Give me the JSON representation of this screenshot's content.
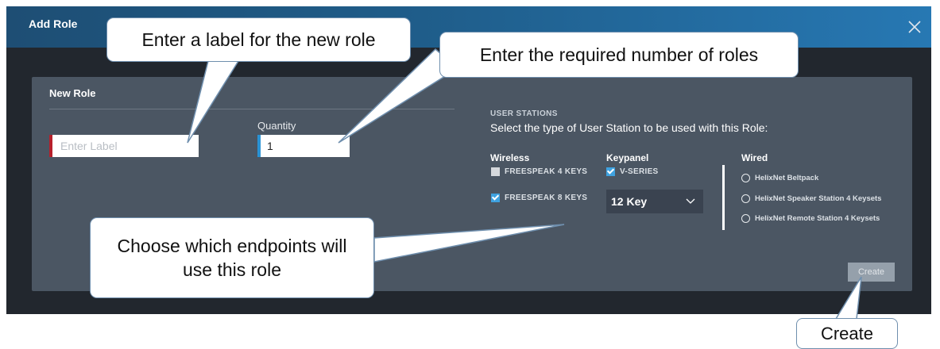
{
  "dialog": {
    "title": "Add Role",
    "close_icon": "close-icon"
  },
  "form": {
    "section_title": "New Role",
    "label_placeholder": "Enter Label",
    "label_value": "",
    "quantity_label": "Quantity",
    "quantity_value": "1"
  },
  "user_stations": {
    "heading": "USER STATIONS",
    "subheading": "Select the type of User Station to be used with this Role:",
    "wireless": {
      "title": "Wireless",
      "options": [
        {
          "label": "FREESPEAK 4 KEYS",
          "checked": false
        },
        {
          "label": "FREESPEAK 8 KEYS",
          "checked": true
        }
      ]
    },
    "keypanel": {
      "title": "Keypanel",
      "option": {
        "label": "V-SERIES",
        "checked": true
      },
      "select_value": "12 Key"
    },
    "wired": {
      "title": "Wired",
      "options": [
        {
          "label": "HelixNet Beltpack",
          "selected": false
        },
        {
          "label": "HelixNet Speaker Station 4 Keysets",
          "selected": false
        },
        {
          "label": "HelixNet Remote Station 4 Keysets",
          "selected": false
        }
      ]
    }
  },
  "actions": {
    "create_label": "Create"
  },
  "callouts": {
    "label": "Enter a label for the new role",
    "quantity": "Enter the required number of roles",
    "endpoints": "Choose which endpoints will use this role",
    "create": "Create"
  },
  "colors": {
    "titlebar_start": "#1e4e74",
    "titlebar_end": "#2778b3",
    "dialog_bg": "#22272e",
    "panel_bg": "#4b5663",
    "label_accent": "#b6202b",
    "quantity_accent": "#2a93d5",
    "checkbox_checked": "#3fa2e0"
  }
}
